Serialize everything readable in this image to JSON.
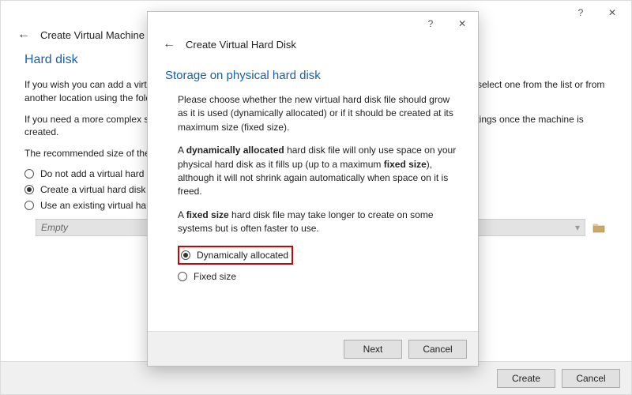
{
  "parent": {
    "title": "Create Virtual Machine",
    "heading": "Hard disk",
    "para1": "If you wish you can add a virtual hard disk to the new machine. You can either create a new hard disk file or select one from the list or from another location using the folder icon.",
    "para2": "If you need a more complex storage set-up you can skip this step and make the changes to the machine settings once the machine is created.",
    "para3": "The recommended size of the hard disk is 50.00 GB.",
    "radio1": "Do not add a virtual hard disk",
    "radio2": "Create a virtual hard disk now",
    "radio3": "Use an existing virtual hard disk file",
    "combo_value": "Empty",
    "create": "Create",
    "cancel": "Cancel"
  },
  "front": {
    "title": "Create Virtual Hard Disk",
    "heading": "Storage on physical hard disk",
    "p1": "Please choose whether the new virtual hard disk file should grow as it is used (dynamically allocated) or if it should be created at its maximum size (fixed size).",
    "p2a": "A ",
    "p2b": "dynamically allocated",
    "p2c": " hard disk file will only use space on your physical hard disk as it fills up (up to a maximum ",
    "p2d": "fixed size",
    "p2e": "), although it will not shrink again automatically when space on it is freed.",
    "p3a": "A ",
    "p3b": "fixed size",
    "p3c": " hard disk file may take longer to create on some systems but is often faster to use.",
    "opt1": "Dynamically allocated",
    "opt2": "Fixed size",
    "next": "Next",
    "cancel": "Cancel"
  }
}
